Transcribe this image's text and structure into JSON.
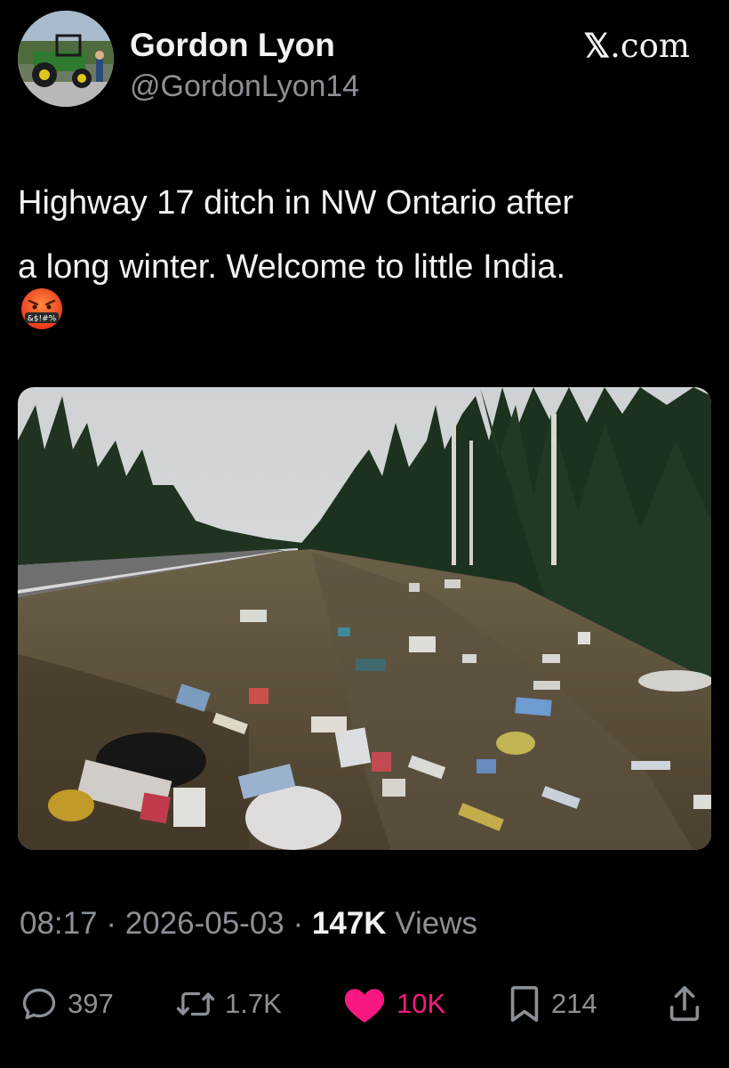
{
  "author": {
    "display_name": "Gordon Lyon",
    "handle": "@GordonLyon14",
    "avatar_icon": "tractor-avatar"
  },
  "brand": {
    "prefix": "𝕏",
    "suffix": ".com"
  },
  "tweet": {
    "text": "Highway 17 ditch in NW Ontario after\na long winter. Welcome to little India.",
    "emoji": "face-with-symbols-on-mouth-icon"
  },
  "media": {
    "description_icon": "roadside-ditch-litter-photo"
  },
  "meta": {
    "time": "08:17",
    "separator": "·",
    "date": "2026-05-03",
    "views_count": "147K",
    "views_label": "Views"
  },
  "actions": {
    "replies": "397",
    "reposts": "1.7K",
    "likes": "10K",
    "bookmarks": "214"
  },
  "colors": {
    "background": "#000000",
    "text": "#e7e9ea",
    "secondary": "#8b9096",
    "like": "#f91880"
  }
}
